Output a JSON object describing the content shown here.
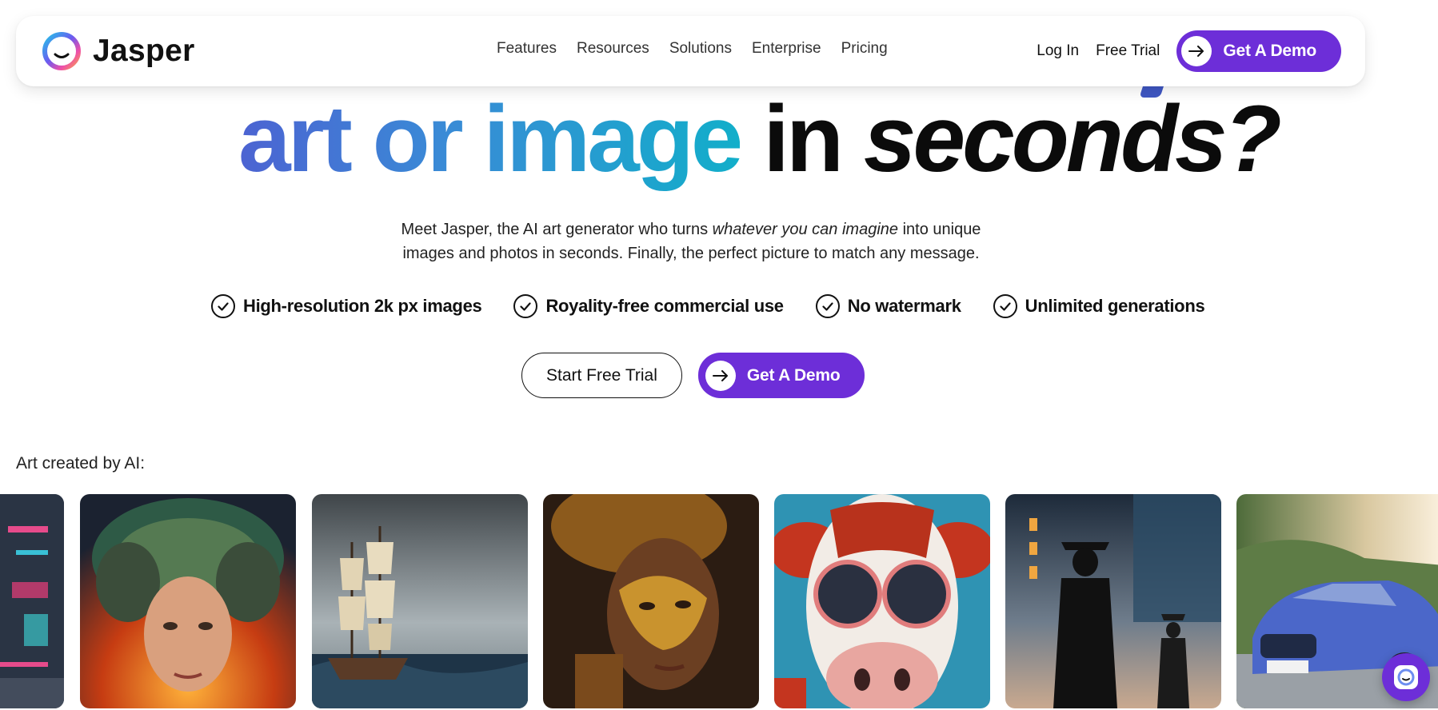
{
  "brand": {
    "name": "Jasper",
    "accent": "#6d2ed8"
  },
  "nav": {
    "links": [
      "Features",
      "Resources",
      "Solutions",
      "Enterprise",
      "Pricing"
    ],
    "login": "Log In",
    "free_trial": "Free Trial",
    "demo": "Get A Demo"
  },
  "hero": {
    "headline_part1": "art or image",
    "headline_part2": "in",
    "headline_part3": "seconds?",
    "subtext_before": "Meet Jasper, the AI art generator who turns ",
    "subtext_italic": "whatever you can imagine",
    "subtext_after": " into unique images and photos in seconds. Finally, the perfect picture to match any message.",
    "features": [
      "High-resolution 2k px images",
      "Royality-free commercial use",
      "No watermark",
      "Unlimited generations"
    ],
    "cta_trial": "Start Free Trial",
    "cta_demo": "Get A Demo"
  },
  "gallery": {
    "label": "Art created by AI:",
    "images": [
      "neon-city-image",
      "viking-warrior-woman-image",
      "sailing-ship-storm-image",
      "golden-mask-woman-image",
      "cow-sunglasses-image",
      "cowboy-silhouette-city-image",
      "blue-car-image"
    ]
  },
  "icons": {
    "arrow": "arrow-right-icon",
    "check": "check-circle-icon",
    "chat": "chat-widget-icon"
  }
}
